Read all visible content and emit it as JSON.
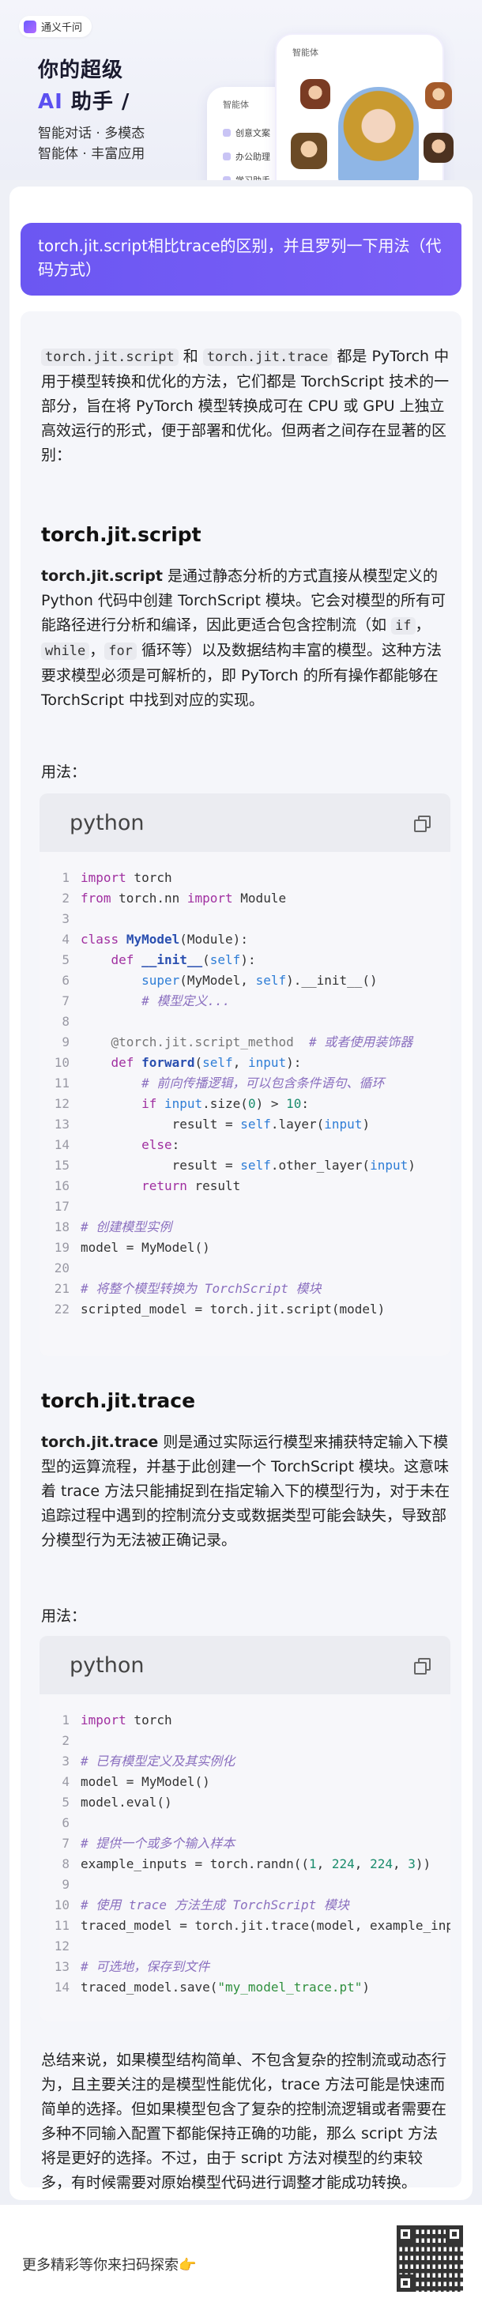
{
  "header": {
    "logo_text": "通义千问",
    "tagline_line1": "你的超级",
    "tagline_ai": "AI",
    "tagline_line2_rest": " 助手 /",
    "feature_line1": "智能对话 · 多模态",
    "feature_line2": "智能体 · 丰富应用",
    "phone_header": "智能体",
    "phone_back_items": [
      "智能体",
      "创意文案",
      "办公助理",
      "学习助手"
    ]
  },
  "question": "torch.jit.script相比trace的区别，并且罗列一下用法（代码方式）",
  "answer": {
    "intro_parts": [
      "torch.jit.script",
      " 和 ",
      "torch.jit.trace",
      " 都是 PyTorch 中用于模型转换和优化的方法，它们都是 TorchScript 技术的一部分，旨在将 PyTorch 模型转换成可在 CPU 或 GPU 上独立高效运行的形式，便于部署和优化。但两者之间存在显著的区别："
    ],
    "section1_title": "torch.jit.script",
    "section1_bold": "torch.jit.script",
    "section1_text_a": " 是通过静态分析的方式直接从模型定义的 Python 代码中创建 TorchScript 模块。它会对模型的所有可能路径进行分析和编译，因此更适合包含控制流（如 ",
    "section1_code_if": "if",
    "section1_sep": "，",
    "section1_code_while": "while",
    "section1_sep2": "，",
    "section1_code_for": "for",
    "section1_text_b": " 循环等）以及数据结构丰富的模型。这种方法要求模型必须是可解析的，即 PyTorch 的所有操作都能够在 TorchScript 中找到对应的实现。",
    "section1_usage": "用法：",
    "section2_title": "torch.jit.trace",
    "section2_bold": "torch.jit.trace",
    "section2_text": " 则是通过实际运行模型来捕获特定输入下模型的运算流程，并基于此创建一个 TorchScript 模块。这意味着 trace 方法只能捕捉到在指定输入下的模型行为，对于未在追踪过程中遇到的控制流分支或数据类型可能会缺失，导致部分模型行为无法被正确记录。",
    "section2_usage": "用法：",
    "conclusion": "总结来说，如果模型结构简单、不包含复杂的控制流或动态行为，且主要关注的是模型性能优化，trace 方法可能是快速而简单的选择。但如果模型包含了复杂的控制流逻辑或者需要在多种不同输入配置下都能保持正确的功能，那么 script 方法将是更好的选择。不过，由于 script 方法对模型的约束较多，有时候需要对原始模型代码进行调整才能成功转换。"
  },
  "code1": {
    "lang": "python",
    "lines": [
      "import torch",
      "from torch.nn import Module",
      "",
      "class MyModel(Module):",
      "    def __init__(self):",
      "        super(MyModel, self).__init__()",
      "        # 模型定义...",
      "",
      "    @torch.jit.script_method  # 或者使用装饰器",
      "    def forward(self, input):",
      "        # 前向传播逻辑，可以包含条件语句、循环",
      "        if input.size(0) > 10:",
      "            result = self.layer(input)",
      "        else:",
      "            result = self.other_layer(input)",
      "        return result",
      "",
      "# 创建模型实例",
      "model = MyModel()",
      "",
      "# 将整个模型转换为 TorchScript 模块",
      "scripted_model = torch.jit.script(model)"
    ]
  },
  "code2": {
    "lang": "python",
    "lines": [
      "import torch",
      "",
      "# 已有模型定义及其实例化",
      "model = MyModel()",
      "model.eval()",
      "",
      "# 提供一个或多个输入样本",
      "example_inputs = torch.randn((1, 224, 224, 3))",
      "",
      "# 使用 trace 方法生成 TorchScript 模块",
      "traced_model = torch.jit.trace(model, example_inputs)",
      "",
      "# 可选地，保存到文件",
      "traced_model.save(\"my_model_trace.pt\")"
    ]
  },
  "footer": {
    "text": "更多精彩等你来扫码探索👉"
  }
}
